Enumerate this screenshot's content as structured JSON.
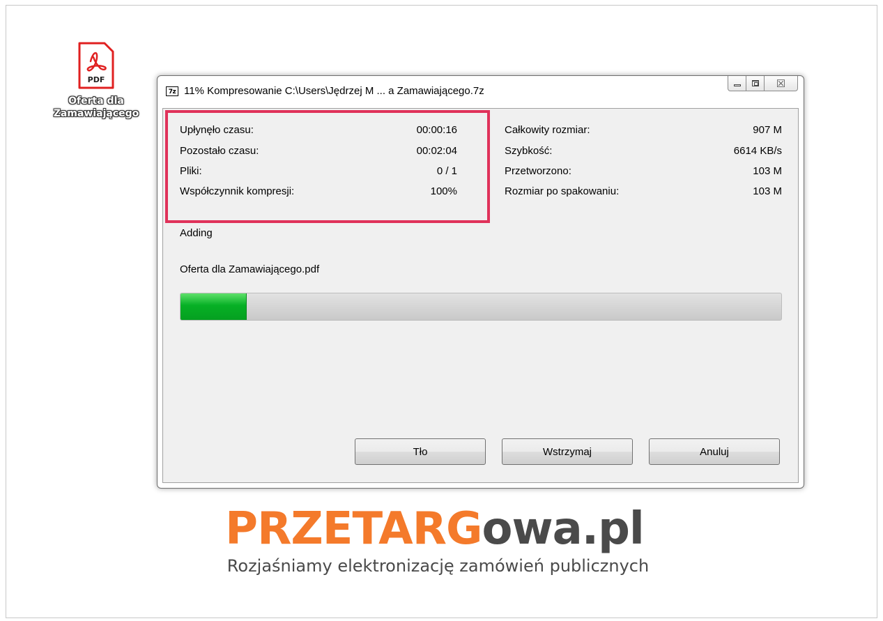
{
  "desktop": {
    "icon_name": "pdf-file-icon",
    "icon_badge": "PDF",
    "label_line1": "Oferta dla",
    "label_line2": "Zamawiającego"
  },
  "window": {
    "app_icon_text": "7z",
    "title": "11% Kompresowanie C:\\Users\\Jędrzej M ... a Zamawiającego.7z",
    "controls": [
      "minimize-icon",
      "maximize-icon",
      "close-icon"
    ],
    "close_glyph": "☒"
  },
  "stats_left": [
    {
      "label": "Upłynęło czasu:",
      "value": "00:00:16"
    },
    {
      "label": "Pozostało czasu:",
      "value": "00:02:04"
    },
    {
      "label": "Pliki:",
      "value": "0 / 1"
    },
    {
      "label": "Współczynnik kompresji:",
      "value": "100%"
    }
  ],
  "stats_right": [
    {
      "label": "Całkowity rozmiar:",
      "value": "907 M"
    },
    {
      "label": "Szybkość:",
      "value": "6614 KB/s"
    },
    {
      "label": "Przetworzono:",
      "value": "103 M"
    },
    {
      "label": "Rozmiar po spakowaniu:",
      "value": "103 M"
    }
  ],
  "status": {
    "action": "Adding",
    "current_file": "Oferta dla Zamawiającego.pdf"
  },
  "progress": {
    "percent": 11,
    "color": "#06b025"
  },
  "buttons": {
    "background": "Tło",
    "pause": "Wstrzymaj",
    "cancel": "Anuluj"
  },
  "logo": {
    "part_orange": "PRZETARG",
    "part_grey": "owa.pl",
    "tagline": "Rozjaśniamy elektronizację zamówień publicznych",
    "orange_color": "#f47a2b",
    "grey_color": "#4a4a4a"
  },
  "highlight_color": "#e0325a"
}
